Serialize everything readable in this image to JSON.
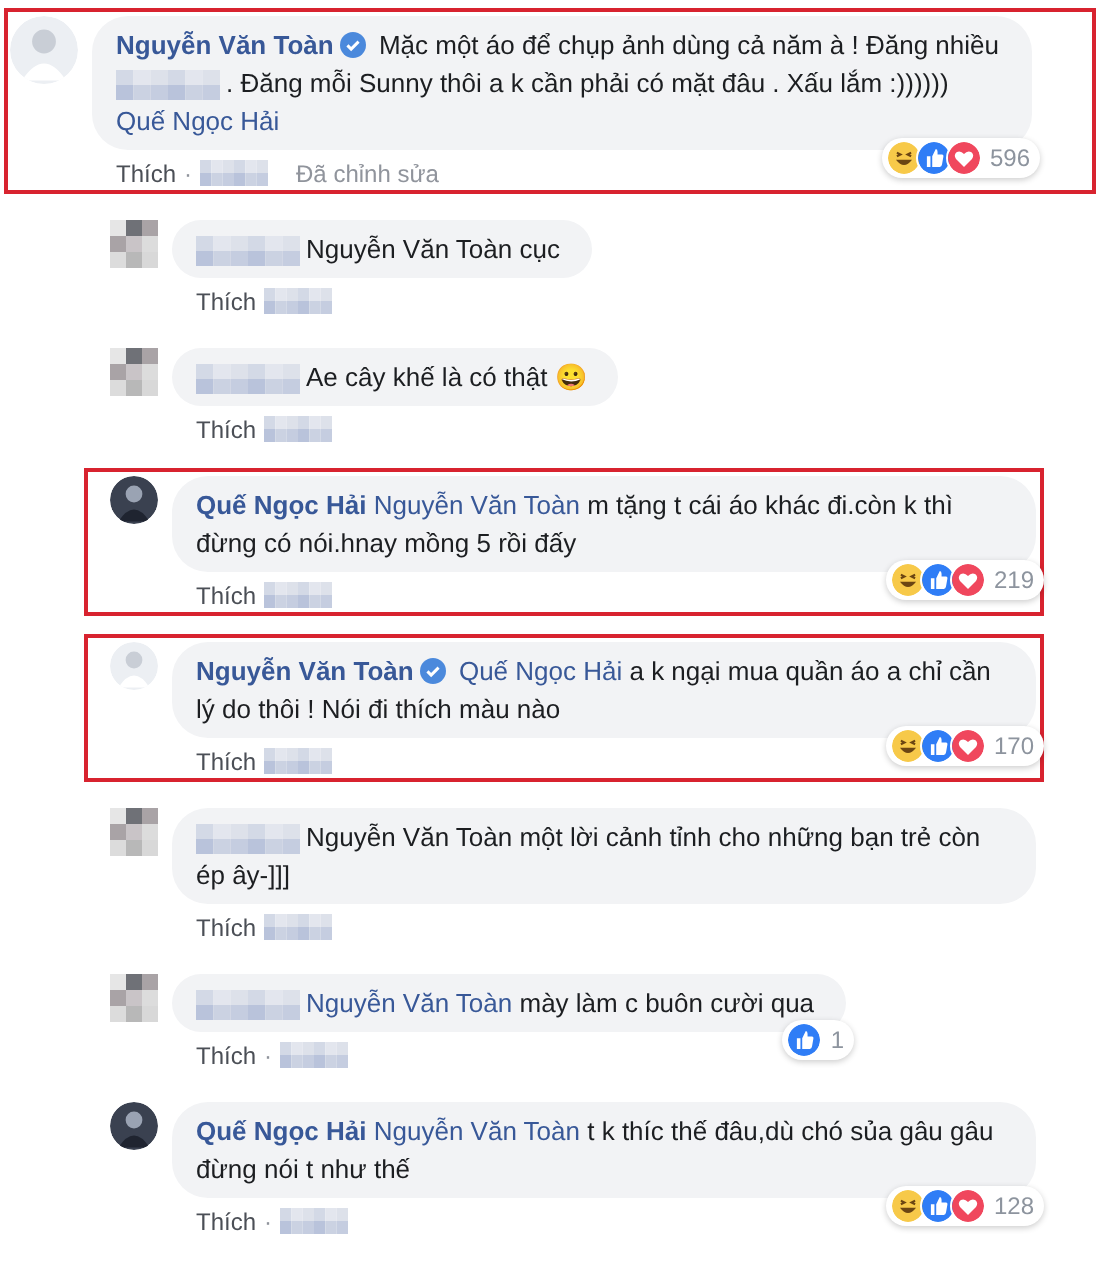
{
  "comments": [
    {
      "reply": false,
      "highlighted": true,
      "avatar": {
        "kind": "light"
      },
      "author": "Nguyễn Văn Toàn",
      "verified": true,
      "body": [
        {
          "kind": "text",
          "text": "Mặc một áo để chụp ảnh dùng cả năm à ! Đăng nhiều"
        },
        {
          "kind": "blur"
        },
        {
          "kind": "text",
          "text": ". Đăng mỗi Sunny thôi a k cần phải có mặt đâu . Xấu lắm :)))))) "
        },
        {
          "kind": "mention",
          "text": "Quế Ngọc Hải"
        }
      ],
      "reactions": {
        "items": [
          {
            "kind": "haha"
          },
          {
            "kind": "like"
          },
          {
            "kind": "love"
          }
        ],
        "count": "596"
      },
      "footer": {
        "like": "Thích",
        "separator": "·",
        "time_blurred": true,
        "edited": "Đã chỉnh sửa"
      }
    },
    {
      "reply": true,
      "highlighted": false,
      "avatar": {
        "kind": "pixelated"
      },
      "body": [
        {
          "kind": "blur"
        },
        {
          "kind": "text",
          "text": "Nguyễn Văn Toàn cục"
        }
      ],
      "footer": {
        "like": "Thích",
        "time_blurred": true
      }
    },
    {
      "reply": true,
      "highlighted": false,
      "avatar": {
        "kind": "pixelated"
      },
      "body": [
        {
          "kind": "blur"
        },
        {
          "kind": "text",
          "text": "Ae cây khế là có thật 😀"
        }
      ],
      "footer": {
        "like": "Thích",
        "time_blurred": true
      }
    },
    {
      "reply": true,
      "highlighted": true,
      "avatar": {
        "kind": "dark"
      },
      "author": "Quế Ngọc Hải",
      "verified": false,
      "body": [
        {
          "kind": "mention",
          "text": "Nguyễn Văn Toàn"
        },
        {
          "kind": "text",
          "text": " m tặng t cái áo khác đi.còn k thì đừng có nói.hnay mồng 5 rồi đấy"
        }
      ],
      "reactions": {
        "items": [
          {
            "kind": "haha"
          },
          {
            "kind": "like"
          },
          {
            "kind": "love"
          }
        ],
        "count": "219"
      },
      "footer": {
        "like": "Thích",
        "time_blurred": true
      }
    },
    {
      "reply": true,
      "highlighted": true,
      "avatar": {
        "kind": "light"
      },
      "author": "Nguyễn Văn Toàn",
      "verified": true,
      "body": [
        {
          "kind": "mention",
          "text": "Quế Ngọc Hải"
        },
        {
          "kind": "text",
          "text": " a k ngại mua quần áo a chỉ cần lý do thôi ! Nói đi thích màu nào"
        }
      ],
      "reactions": {
        "items": [
          {
            "kind": "haha"
          },
          {
            "kind": "like"
          },
          {
            "kind": "love"
          }
        ],
        "count": "170"
      },
      "footer": {
        "like": "Thích",
        "time_blurred": true
      }
    },
    {
      "reply": true,
      "highlighted": false,
      "avatar": {
        "kind": "pixelated"
      },
      "body": [
        {
          "kind": "blur"
        },
        {
          "kind": "text",
          "text": "Nguyễn Văn Toàn một lời cảnh tỉnh cho những bạn trẻ còn ép ây-]]]"
        }
      ],
      "footer": {
        "like": "Thích",
        "time_blurred": true
      }
    },
    {
      "reply": true,
      "highlighted": false,
      "avatar": {
        "kind": "pixelated"
      },
      "body": [
        {
          "kind": "blur"
        },
        {
          "kind": "mention",
          "text": "Nguyễn Văn Toàn"
        },
        {
          "kind": "text",
          "text": " mày làm c buôn cười qua"
        }
      ],
      "reactions": {
        "items": [
          {
            "kind": "like"
          }
        ],
        "count": "1"
      },
      "footer": {
        "like": "Thích",
        "separator": "·",
        "time_blurred": true
      }
    },
    {
      "reply": true,
      "highlighted": false,
      "avatar": {
        "kind": "dark"
      },
      "author": "Quế Ngọc Hải",
      "verified": false,
      "body": [
        {
          "kind": "mention",
          "text": "Nguyễn Văn Toàn"
        },
        {
          "kind": "text",
          "text": " t k thíc thế đâu,dù chó sủa gâu gâu đừng nói t như thế"
        }
      ],
      "reactions": {
        "items": [
          {
            "kind": "haha"
          },
          {
            "kind": "like"
          },
          {
            "kind": "love"
          }
        ],
        "count": "128"
      },
      "footer": {
        "like": "Thích",
        "separator": "·",
        "time_blurred": true
      }
    }
  ]
}
